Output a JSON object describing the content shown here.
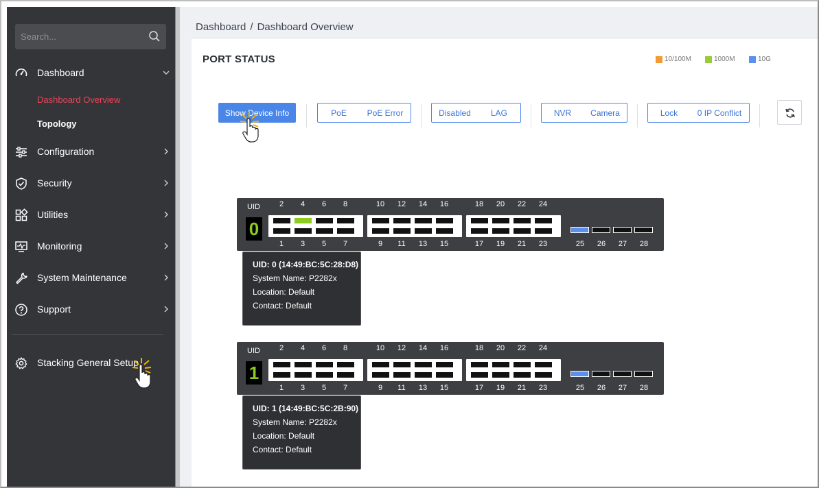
{
  "sidebar": {
    "search_placeholder": "Search...",
    "items": [
      {
        "label": "Dashboard",
        "icon": "speedometer-icon"
      },
      {
        "label": "Configuration",
        "icon": "sliders-icon"
      },
      {
        "label": "Security",
        "icon": "shield-check-icon"
      },
      {
        "label": "Utilities",
        "icon": "grid-icon"
      },
      {
        "label": "Monitoring",
        "icon": "monitor-icon"
      },
      {
        "label": "System Maintenance",
        "icon": "wrench-icon"
      },
      {
        "label": "Support",
        "icon": "help-circle-icon"
      },
      {
        "label": "Stacking General Setup",
        "icon": "gear-icon"
      }
    ],
    "sub_items": [
      {
        "label": "Dashboard Overview",
        "active": true
      },
      {
        "label": "Topology",
        "active": false
      }
    ]
  },
  "breadcrumb": [
    "Dashboard",
    "/",
    "Dashboard Overview"
  ],
  "port_status": {
    "title": "PORT STATUS",
    "legend": [
      {
        "label": "10/100M",
        "color": "#f39a32"
      },
      {
        "label": "1000M",
        "color": "#9ccb3a"
      },
      {
        "label": "10G",
        "color": "#5b8ff0"
      }
    ],
    "buttons": {
      "show_device_info": "Show Device Info",
      "poe": "PoE",
      "poe_error": "PoE Error",
      "disabled": "Disabled",
      "lag": "LAG",
      "nvr": "NVR",
      "camera": "Camera",
      "lock": "Lock",
      "ip_conflict": "0 IP Conflict"
    }
  },
  "switches": [
    {
      "uid_label": "UID",
      "uid": "0",
      "top_numbers": [
        "2",
        "4",
        "6",
        "8",
        "10",
        "12",
        "14",
        "16",
        "18",
        "20",
        "22",
        "24"
      ],
      "bottom_numbers": [
        "1",
        "3",
        "5",
        "7",
        "9",
        "11",
        "13",
        "15",
        "17",
        "19",
        "21",
        "23"
      ],
      "sfp_numbers": [
        "25",
        "26",
        "27",
        "28"
      ],
      "active_port": "4",
      "sfp_active": "25",
      "info": {
        "uid_line": "UID: 0 (14:49:BC:5C:28:D8)",
        "system_name": "System Name: P2282x",
        "location": "Location: Default",
        "contact": "Contact: Default"
      }
    },
    {
      "uid_label": "UID",
      "uid": "1",
      "top_numbers": [
        "2",
        "4",
        "6",
        "8",
        "10",
        "12",
        "14",
        "16",
        "18",
        "20",
        "22",
        "24"
      ],
      "bottom_numbers": [
        "1",
        "3",
        "5",
        "7",
        "9",
        "11",
        "13",
        "15",
        "17",
        "19",
        "21",
        "23"
      ],
      "sfp_numbers": [
        "25",
        "26",
        "27",
        "28"
      ],
      "active_port": "",
      "sfp_active": "25",
      "info": {
        "uid_line": "UID: 1 (14:49:BC:5C:2B:90)",
        "system_name": "System Name: P2282x",
        "location": "Location: Default",
        "contact": "Contact: Default"
      }
    }
  ],
  "colors": {
    "accent": "#4a86e8",
    "active_sub": "#e8455a",
    "sidebar_bg": "#333538",
    "uid_green": "#8ccc1e"
  }
}
